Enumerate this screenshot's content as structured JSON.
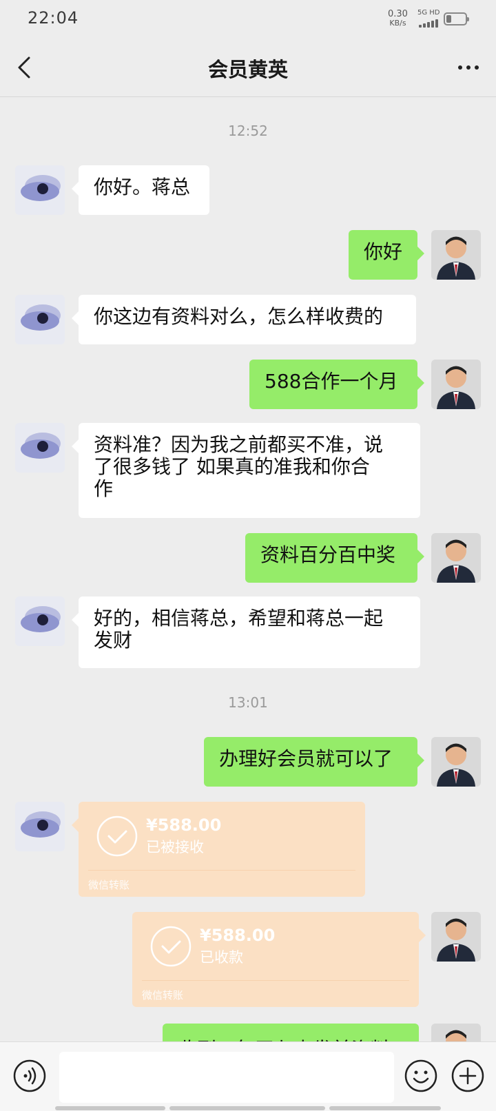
{
  "status_bar": {
    "time": "22:04",
    "net_speed": "0.30",
    "net_unit": "KB/s",
    "network": "5G HD"
  },
  "header": {
    "title": "会员黄英"
  },
  "messages": {
    "ts1": "12:52",
    "m1": "你好。蒋总",
    "m2": "你好",
    "m3": "你这边有资料对么，怎么样收费的",
    "m4": "588合作一个月",
    "m5_l1": "资料准？因为我之前都买不准，说",
    "m5_l2": "了很多钱了 如果真的准我和你合",
    "m5_l3": "作",
    "m6": "资料百分百中奖",
    "m7_l1": "好的，相信蒋总，希望和蒋总一起",
    "m7_l2": "发财",
    "ts2": "13:01",
    "m8": "办理好会员就可以了",
    "transfer1": {
      "amount": "¥588.00",
      "status": "已被接收",
      "label": "微信转账"
    },
    "transfer2": {
      "amount": "¥588.00",
      "status": "已收款",
      "label": "微信转账"
    },
    "partial": "收到，每天七点发前资料"
  },
  "colors": {
    "self_bubble": "#95ec69",
    "transfer": "#fbe0c4",
    "background": "#ededed"
  }
}
